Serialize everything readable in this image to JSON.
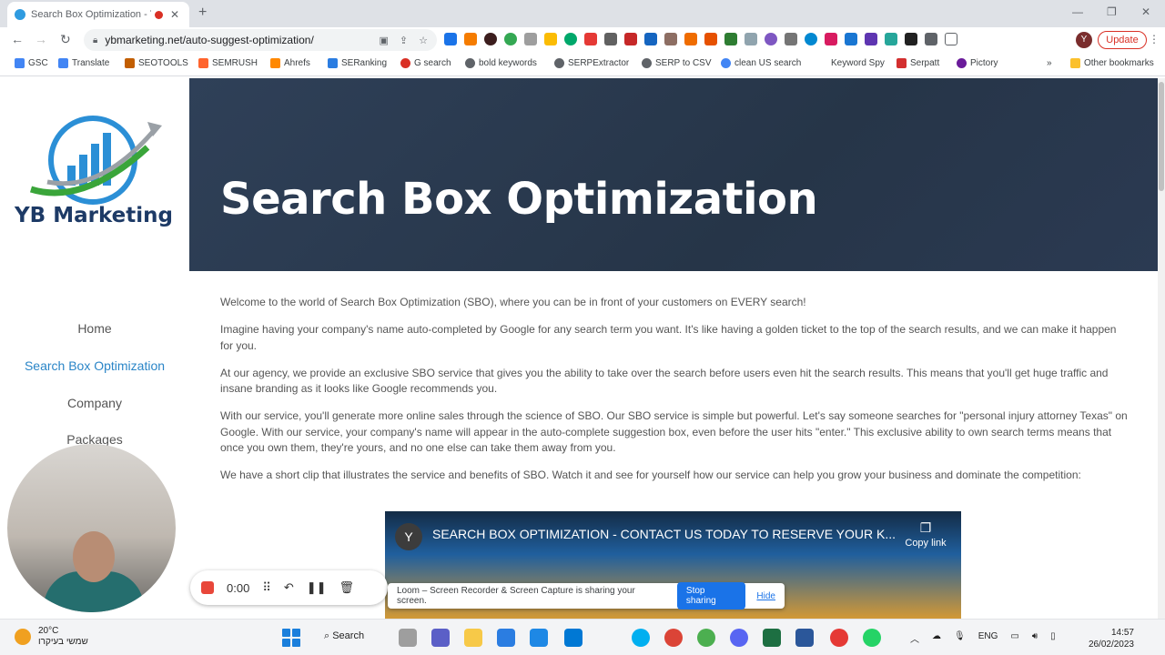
{
  "browser": {
    "tab_title": "Search Box Optimization - Y",
    "new_tab": "+",
    "url": "ybmarketing.net/auto-suggest-optimization/",
    "profile_initial": "Y",
    "update_label": "Update",
    "bookmarks": [
      "GSC",
      "Translate",
      "SEOTOOLS",
      "SEMRUSH",
      "Ahrefs",
      "SERanking",
      "G search",
      "bold keywords",
      "SERPExtractor",
      "SERP to CSV",
      "clean US search",
      "Keyword Spy",
      "Serpatt",
      "Pictory",
      "»",
      "Other bookmarks"
    ]
  },
  "site": {
    "logo_text": "YB Marketing",
    "nav": [
      "Home",
      "Search Box Optimization",
      "Company",
      "Packages"
    ],
    "active_nav": "Search Box Optimization",
    "hero_title": "Search Box Optimization",
    "paragraphs": [
      "Welcome to the world of Search Box Optimization (SBO), where you can be in front of your customers on EVERY search!",
      "Imagine having your company's name auto-completed by Google for any search term you want. It's like having a golden ticket to the top of the search results, and we can make it happen for you.",
      "At our agency, we provide an exclusive SBO service that gives you the ability to take over the search before users even hit the search results. This means that you'll get huge traffic and insane branding as it looks like Google recommends you.",
      "With our service, you'll generate more online sales through the science of SBO. Our SBO service is simple but powerful. Let's say someone searches for \"personal injury attorney Texas\" on Google. With our service, your company's name will appear in the auto-complete suggestion box, even before the user hits \"enter.\" This exclusive ability to own search terms means that once you own them, they're yours, and no one else can take them away from you.",
      "We have a short clip that illustrates the service and benefits of SBO. Watch it and see for yourself how our service can help you grow your business and dominate the competition:"
    ],
    "video": {
      "channel_initial": "Y",
      "title": "SEARCH BOX OPTIMIZATION - CONTACT US TODAY TO RESERVE YOUR K...",
      "copy_link": "Copy link"
    }
  },
  "loom": {
    "timer": "0:00",
    "share_message": "Loom – Screen Recorder & Screen Capture is sharing your screen.",
    "stop_sharing": "Stop sharing",
    "hide": "Hide"
  },
  "taskbar": {
    "temperature": "20°C",
    "weather_desc": "שמשי בעיקרו",
    "search_label": "Search",
    "language": "ENG",
    "time": "14:57",
    "date": "26/02/2023"
  }
}
